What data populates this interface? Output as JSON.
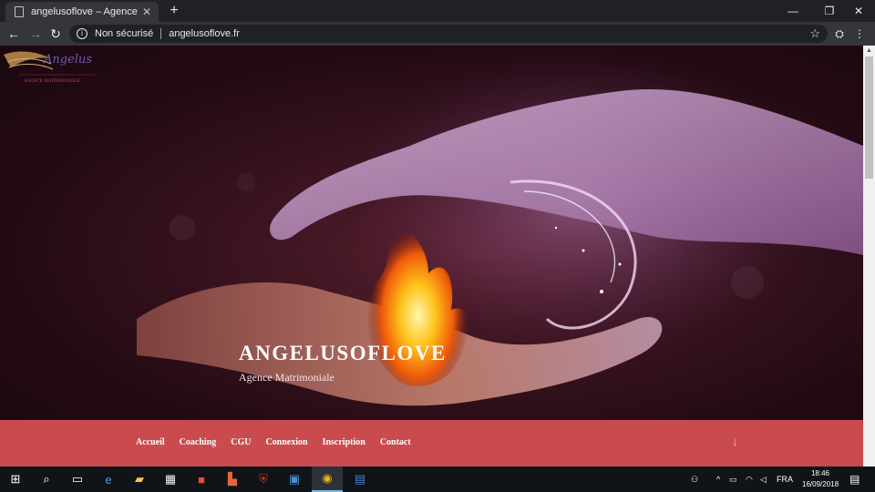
{
  "browser": {
    "tab_title": "angelusoflove – Agence Matrimoniale",
    "new_tab_icon": "+",
    "security_label": "Non sécurisé",
    "url": "angelusoflove.fr"
  },
  "site": {
    "title": "ANGELUSOFLOVE",
    "tagline": "Agence Matrimoniale",
    "logo_text": "Angelus",
    "logo_subtext": "AGENCE MATRIMONIALE"
  },
  "menu": [
    {
      "label": "Accueil"
    },
    {
      "label": "Coaching"
    },
    {
      "label": "CGU"
    },
    {
      "label": "Connexion"
    },
    {
      "label": "Inscription"
    },
    {
      "label": "Contact"
    }
  ],
  "taskbar": {
    "language": "FRA",
    "time": "18:46",
    "date": "16/09/2018"
  },
  "colors": {
    "menu_bar": "#c94b4e",
    "hero_dark": "#230a13"
  }
}
